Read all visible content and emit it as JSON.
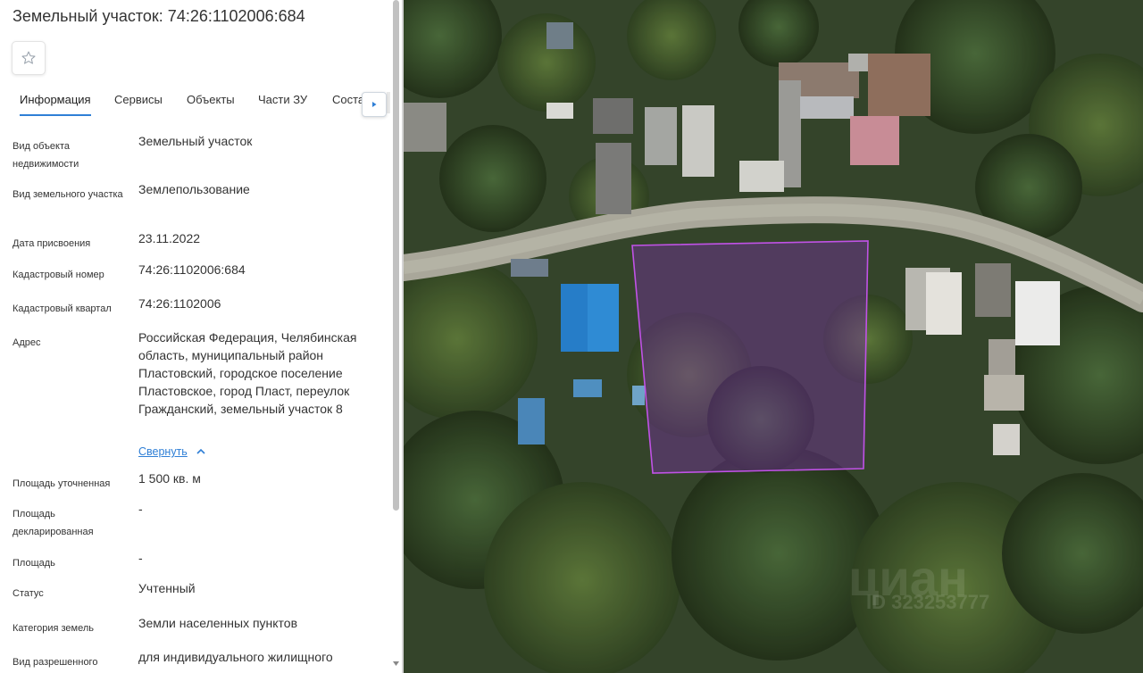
{
  "header": {
    "title": "Земельный участок: 74:26:1102006:684"
  },
  "favorite": {
    "icon": "star-outline-icon"
  },
  "tabs": [
    {
      "label": "Информация",
      "active": true
    },
    {
      "label": "Сервисы"
    },
    {
      "label": "Объекты"
    },
    {
      "label": "Части ЗУ"
    },
    {
      "label": "Соста"
    }
  ],
  "tab_scroll": {
    "icon": "caret-right-icon"
  },
  "fields": [
    {
      "label": "Вид объекта недвижимости",
      "value": "Земельный участок"
    },
    {
      "label": "Вид земельного участка",
      "value": "Землепользование"
    },
    {
      "label": "Дата присвоения",
      "value": "23.11.2022"
    },
    {
      "label": "Кадастровый номер",
      "value": "74:26:1102006:684"
    },
    {
      "label": "Кадастровый квартал",
      "value": "74:26:1102006"
    },
    {
      "label": "Адрес",
      "value": "Российская Федерация, Челябинская область, муниципальный район Пластовский, городское поселение Пластовское, город Пласт, переулок Гражданский, земельный участок 8"
    },
    {
      "label": "Площадь уточненная",
      "value": "1 500 кв. м"
    },
    {
      "label": "Площадь декларированная",
      "value": "-"
    },
    {
      "label": "Площадь",
      "value": "-"
    },
    {
      "label": "Статус",
      "value": "Учтенный"
    },
    {
      "label": "Категория земель",
      "value": "Земли населенных пунктов"
    },
    {
      "label": "Вид разрешенного",
      "value": "для индивидуального жилищного"
    }
  ],
  "address_toggle": {
    "label": "Свернуть",
    "icon": "chevron-up-icon"
  },
  "map": {
    "watermark": "циан",
    "watermark_id": "ID 323253777",
    "parcel_color": "#b84fd8"
  }
}
